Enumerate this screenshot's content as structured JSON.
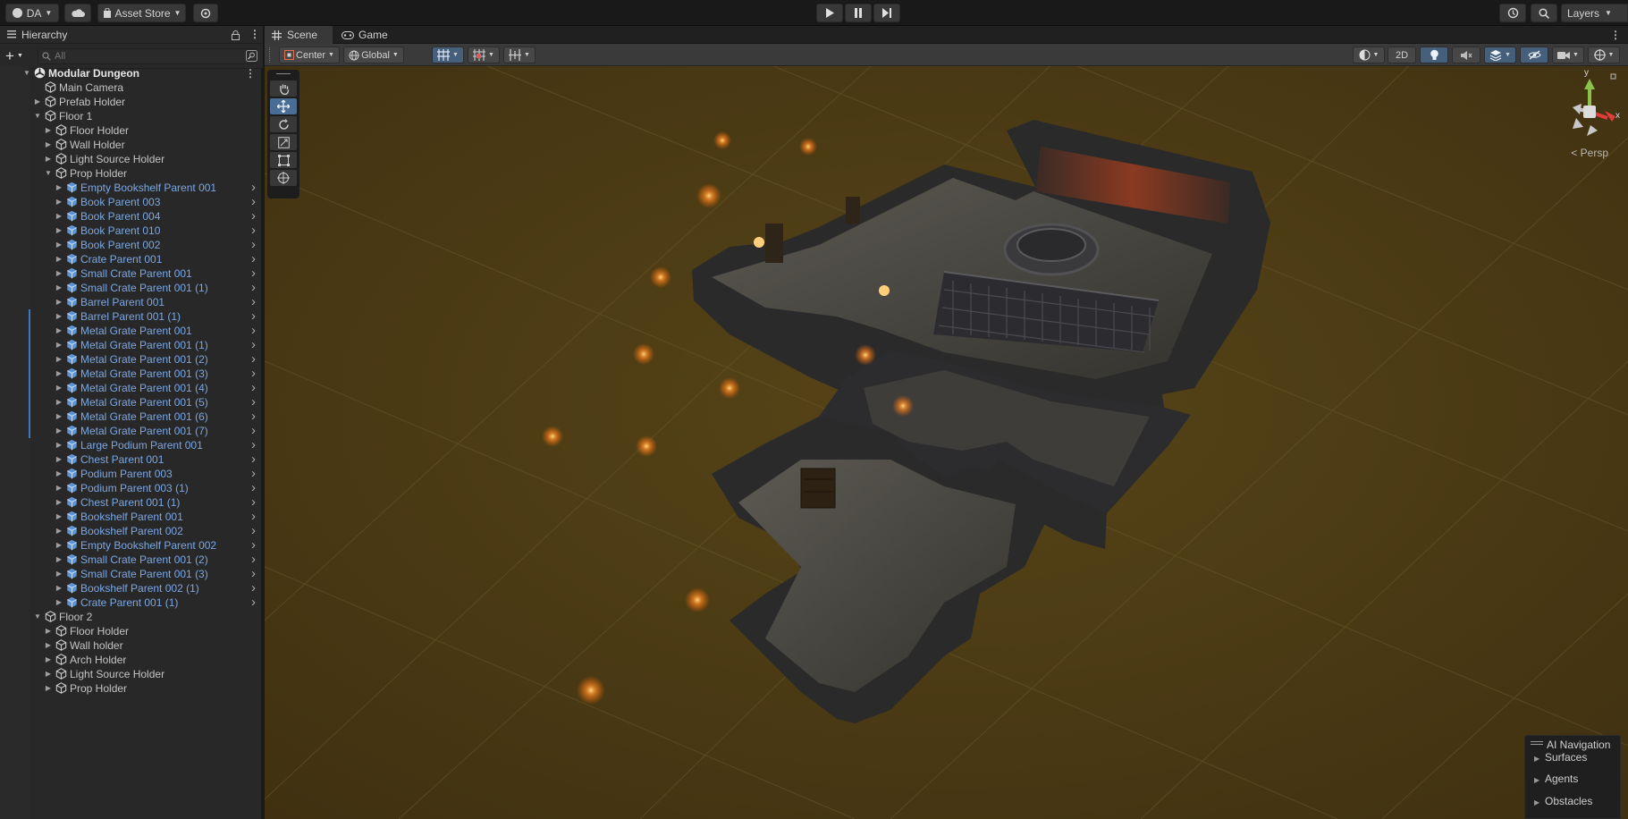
{
  "topbar": {
    "account": "DA",
    "asset_store": "Asset Store",
    "layers": "Layers"
  },
  "hierarchy": {
    "tab_label": "Hierarchy",
    "search_placeholder": "All",
    "rows": [
      {
        "label": "Modular Dungeon",
        "depth": 0,
        "kind": "scene",
        "expand": "open",
        "arrow": false,
        "marker": false
      },
      {
        "label": "Main Camera",
        "depth": 1,
        "kind": "object",
        "expand": "none",
        "arrow": false,
        "marker": false
      },
      {
        "label": "Prefab Holder",
        "depth": 1,
        "kind": "object",
        "expand": "closed",
        "arrow": false,
        "marker": false
      },
      {
        "label": "Floor 1",
        "depth": 1,
        "kind": "object",
        "expand": "open",
        "arrow": false,
        "marker": false
      },
      {
        "label": "Floor Holder",
        "depth": 2,
        "kind": "object",
        "expand": "closed",
        "arrow": false,
        "marker": false
      },
      {
        "label": "Wall Holder",
        "depth": 2,
        "kind": "object",
        "expand": "closed",
        "arrow": false,
        "marker": false
      },
      {
        "label": "Light Source Holder",
        "depth": 2,
        "kind": "object",
        "expand": "closed",
        "arrow": false,
        "marker": false
      },
      {
        "label": "Prop Holder",
        "depth": 2,
        "kind": "object",
        "expand": "open",
        "arrow": false,
        "marker": false
      },
      {
        "label": "Empty Bookshelf Parent 001",
        "depth": 3,
        "kind": "prefab",
        "expand": "closed",
        "arrow": true,
        "marker": false
      },
      {
        "label": "Book Parent 003",
        "depth": 3,
        "kind": "prefab",
        "expand": "closed",
        "arrow": true,
        "marker": false
      },
      {
        "label": "Book Parent 004",
        "depth": 3,
        "kind": "prefab",
        "expand": "closed",
        "arrow": true,
        "marker": false
      },
      {
        "label": "Book Parent 010",
        "depth": 3,
        "kind": "prefab",
        "expand": "closed",
        "arrow": true,
        "marker": false
      },
      {
        "label": "Book Parent 002",
        "depth": 3,
        "kind": "prefab",
        "expand": "closed",
        "arrow": true,
        "marker": false
      },
      {
        "label": "Crate Parent 001",
        "depth": 3,
        "kind": "prefab",
        "expand": "closed",
        "arrow": true,
        "marker": false
      },
      {
        "label": "Small Crate Parent 001",
        "depth": 3,
        "kind": "prefab",
        "expand": "closed",
        "arrow": true,
        "marker": false
      },
      {
        "label": "Small Crate Parent 001 (1)",
        "depth": 3,
        "kind": "prefab",
        "expand": "closed",
        "arrow": true,
        "marker": false
      },
      {
        "label": "Barrel Parent 001",
        "depth": 3,
        "kind": "prefab",
        "expand": "closed",
        "arrow": true,
        "marker": false
      },
      {
        "label": "Barrel Parent 001 (1)",
        "depth": 3,
        "kind": "prefab",
        "expand": "closed",
        "arrow": true,
        "marker": true
      },
      {
        "label": "Metal Grate Parent 001",
        "depth": 3,
        "kind": "prefab",
        "expand": "closed",
        "arrow": true,
        "marker": true
      },
      {
        "label": "Metal Grate Parent 001 (1)",
        "depth": 3,
        "kind": "prefab",
        "expand": "closed",
        "arrow": true,
        "marker": true
      },
      {
        "label": "Metal Grate Parent 001 (2)",
        "depth": 3,
        "kind": "prefab",
        "expand": "closed",
        "arrow": true,
        "marker": true
      },
      {
        "label": "Metal Grate Parent 001 (3)",
        "depth": 3,
        "kind": "prefab",
        "expand": "closed",
        "arrow": true,
        "marker": true
      },
      {
        "label": "Metal Grate Parent 001 (4)",
        "depth": 3,
        "kind": "prefab",
        "expand": "closed",
        "arrow": true,
        "marker": true
      },
      {
        "label": "Metal Grate Parent 001 (5)",
        "depth": 3,
        "kind": "prefab",
        "expand": "closed",
        "arrow": true,
        "marker": true
      },
      {
        "label": "Metal Grate Parent 001 (6)",
        "depth": 3,
        "kind": "prefab",
        "expand": "closed",
        "arrow": true,
        "marker": true
      },
      {
        "label": "Metal Grate Parent 001 (7)",
        "depth": 3,
        "kind": "prefab",
        "expand": "closed",
        "arrow": true,
        "marker": true
      },
      {
        "label": "Large Podium Parent 001",
        "depth": 3,
        "kind": "prefab",
        "expand": "closed",
        "arrow": true,
        "marker": false
      },
      {
        "label": "Chest Parent 001",
        "depth": 3,
        "kind": "prefab",
        "expand": "closed",
        "arrow": true,
        "marker": false
      },
      {
        "label": "Podium Parent 003",
        "depth": 3,
        "kind": "prefab",
        "expand": "closed",
        "arrow": true,
        "marker": false
      },
      {
        "label": "Podium Parent 003 (1)",
        "depth": 3,
        "kind": "prefab",
        "expand": "closed",
        "arrow": true,
        "marker": false
      },
      {
        "label": "Chest Parent 001 (1)",
        "depth": 3,
        "kind": "prefab",
        "expand": "closed",
        "arrow": true,
        "marker": false
      },
      {
        "label": "Bookshelf Parent 001",
        "depth": 3,
        "kind": "prefab",
        "expand": "closed",
        "arrow": true,
        "marker": false
      },
      {
        "label": "Bookshelf Parent 002",
        "depth": 3,
        "kind": "prefab",
        "expand": "closed",
        "arrow": true,
        "marker": false
      },
      {
        "label": "Empty Bookshelf Parent 002",
        "depth": 3,
        "kind": "prefab",
        "expand": "closed",
        "arrow": true,
        "marker": false
      },
      {
        "label": "Small Crate Parent 001 (2)",
        "depth": 3,
        "kind": "prefab",
        "expand": "closed",
        "arrow": true,
        "marker": false
      },
      {
        "label": "Small Crate Parent 001 (3)",
        "depth": 3,
        "kind": "prefab",
        "expand": "closed",
        "arrow": true,
        "marker": false
      },
      {
        "label": "Bookshelf Parent 002 (1)",
        "depth": 3,
        "kind": "prefab",
        "expand": "closed",
        "arrow": true,
        "marker": false
      },
      {
        "label": "Crate Parent 001 (1)",
        "depth": 3,
        "kind": "prefab",
        "expand": "closed",
        "arrow": true,
        "marker": false
      },
      {
        "label": "Floor 2",
        "depth": 1,
        "kind": "object",
        "expand": "open",
        "arrow": false,
        "marker": false
      },
      {
        "label": "Floor Holder",
        "depth": 2,
        "kind": "object",
        "expand": "closed",
        "arrow": false,
        "marker": false
      },
      {
        "label": "Wall holder",
        "depth": 2,
        "kind": "object",
        "expand": "closed",
        "arrow": false,
        "marker": false
      },
      {
        "label": "Arch Holder",
        "depth": 2,
        "kind": "object",
        "expand": "closed",
        "arrow": false,
        "marker": false
      },
      {
        "label": "Light Source Holder",
        "depth": 2,
        "kind": "object",
        "expand": "closed",
        "arrow": false,
        "marker": false
      },
      {
        "label": "Prop Holder",
        "depth": 2,
        "kind": "object",
        "expand": "closed",
        "arrow": false,
        "marker": false
      }
    ]
  },
  "scene_view": {
    "tabs": [
      {
        "label": "Scene",
        "icon": "grid-icon"
      },
      {
        "label": "Game",
        "icon": "gamepad-icon"
      }
    ],
    "toolbar": {
      "pivot": "Center",
      "space": "Global",
      "mode_2d": "2D"
    },
    "tools": [
      "hand-tool",
      "move-tool",
      "rotate-tool",
      "scale-tool",
      "rect-tool",
      "transform-tool"
    ],
    "active_tool": "move-tool",
    "gizmo_axes": {
      "y": "y",
      "x": "x"
    },
    "projection": "Persp",
    "ai_navigation": {
      "title": "AI Navigation",
      "items": [
        "Surfaces",
        "Agents",
        "Obstacles"
      ]
    }
  },
  "colors": {
    "scene_background": "#4a3a13",
    "prefab_text": "#7ba7e4",
    "accent_blue": "#46607c",
    "torch": "#ff9a2e"
  }
}
